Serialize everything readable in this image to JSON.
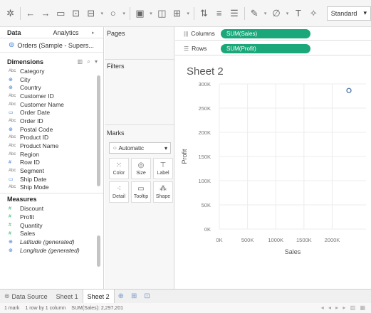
{
  "toolbar": {
    "icons": [
      "tableau-logo-icon",
      "back-icon",
      "forward-icon",
      "save-icon",
      "new-datasource-icon",
      "add-sheet-icon",
      "redo-icon",
      "chart-icon",
      "duplicate-icon",
      "swap-icon",
      "sort-ascending-icon",
      "sort-descending-icon",
      "highlight-icon",
      "group-icon",
      "label-icon",
      "pin-icon"
    ],
    "fit_value": "Standard"
  },
  "data_pane": {
    "tabs": [
      "Data",
      "Analytics"
    ],
    "datasource": "Orders (Sample - Supers...",
    "dimensions_title": "Dimensions",
    "dimensions": [
      {
        "type": "Abc",
        "name": "Category"
      },
      {
        "type": "geo",
        "name": "City"
      },
      {
        "type": "geo",
        "name": "Country"
      },
      {
        "type": "Abc",
        "name": "Customer ID"
      },
      {
        "type": "Abc",
        "name": "Customer Name"
      },
      {
        "type": "date",
        "name": "Order Date"
      },
      {
        "type": "Abc",
        "name": "Order ID"
      },
      {
        "type": "geo",
        "name": "Postal Code"
      },
      {
        "type": "Abc",
        "name": "Product ID"
      },
      {
        "type": "Abc",
        "name": "Product Name"
      },
      {
        "type": "Abc",
        "name": "Region"
      },
      {
        "type": "num",
        "name": "Row ID"
      },
      {
        "type": "Abc",
        "name": "Segment"
      },
      {
        "type": "date",
        "name": "Ship Date"
      },
      {
        "type": "Abc",
        "name": "Ship Mode"
      }
    ],
    "measures_title": "Measures",
    "measures": [
      {
        "type": "#",
        "name": "Discount",
        "italic": false
      },
      {
        "type": "#",
        "name": "Profit",
        "italic": false
      },
      {
        "type": "#",
        "name": "Quantity",
        "italic": false
      },
      {
        "type": "#",
        "name": "Sales",
        "italic": false
      },
      {
        "type": "geo",
        "name": "Latitude (generated)",
        "italic": true
      },
      {
        "type": "geo",
        "name": "Longitude (generated)",
        "italic": true
      }
    ]
  },
  "cards": {
    "pages": "Pages",
    "filters": "Filters",
    "marks": "Marks",
    "mark_type": "Automatic",
    "mark_buttons": [
      {
        "label": "Color",
        "icon": "color-icon"
      },
      {
        "label": "Size",
        "icon": "size-icon"
      },
      {
        "label": "Label",
        "icon": "label-icon"
      },
      {
        "label": "Detail",
        "icon": "detail-icon"
      },
      {
        "label": "Tooltip",
        "icon": "tooltip-icon"
      },
      {
        "label": "Shape",
        "icon": "shape-icon"
      }
    ]
  },
  "shelves": {
    "columns_label": "Columns",
    "columns_pill": "SUM(Sales)",
    "rows_label": "Rows",
    "rows_pill": "SUM(Profit)",
    "pill_color": "#1aa87a"
  },
  "sheet_title": "Sheet 2",
  "chart_data": {
    "type": "scatter",
    "xlabel": "Sales",
    "ylabel": "Profit",
    "x_ticks": [
      "0K",
      "500K",
      "1000K",
      "1500K",
      "2000K"
    ],
    "y_ticks": [
      "0K",
      "50K",
      "100K",
      "150K",
      "200K",
      "250K",
      "300K"
    ],
    "xlim": [
      0,
      2600000
    ],
    "ylim": [
      0,
      300000
    ],
    "points": [
      {
        "x": 2297201,
        "y": 286397
      }
    ],
    "marker_color": "#4e79a7",
    "grid": true
  },
  "bottom_tabs": {
    "datasource": "Data Source",
    "sheets": [
      "Sheet 1",
      "Sheet 2"
    ],
    "active": "Sheet 2"
  },
  "status": {
    "marks": "1 mark",
    "rows_cols": "1 row by 1 column",
    "sum": "SUM(Sales): 2,297,201"
  }
}
